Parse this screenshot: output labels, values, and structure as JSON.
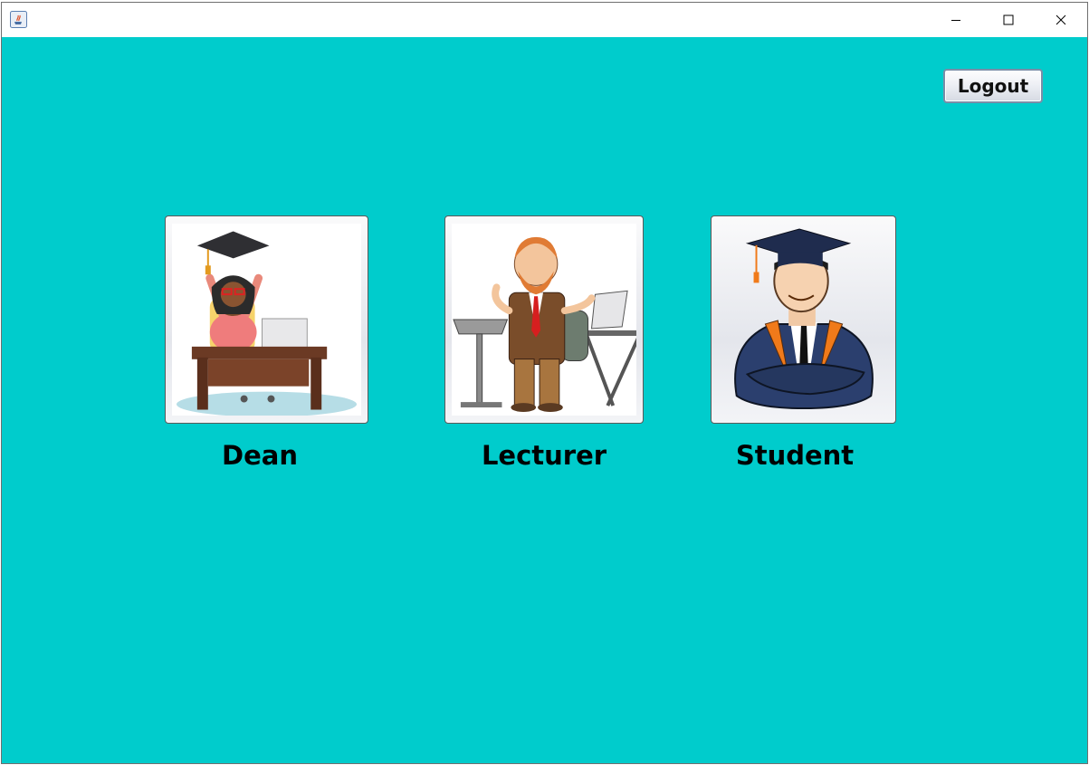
{
  "window": {
    "controls": {
      "minimize_icon": "minimize-icon",
      "maximize_icon": "maximize-icon",
      "close_icon": "close-icon"
    }
  },
  "colors": {
    "background": "#00cccc",
    "titlebar": "#ffffff"
  },
  "toolbar": {
    "logout_label": "Logout"
  },
  "roles": [
    {
      "label": "Dean",
      "illustration": "dean-illustration"
    },
    {
      "label": "Lecturer",
      "illustration": "lecturer-illustration"
    },
    {
      "label": "Student",
      "illustration": "student-illustration"
    }
  ]
}
